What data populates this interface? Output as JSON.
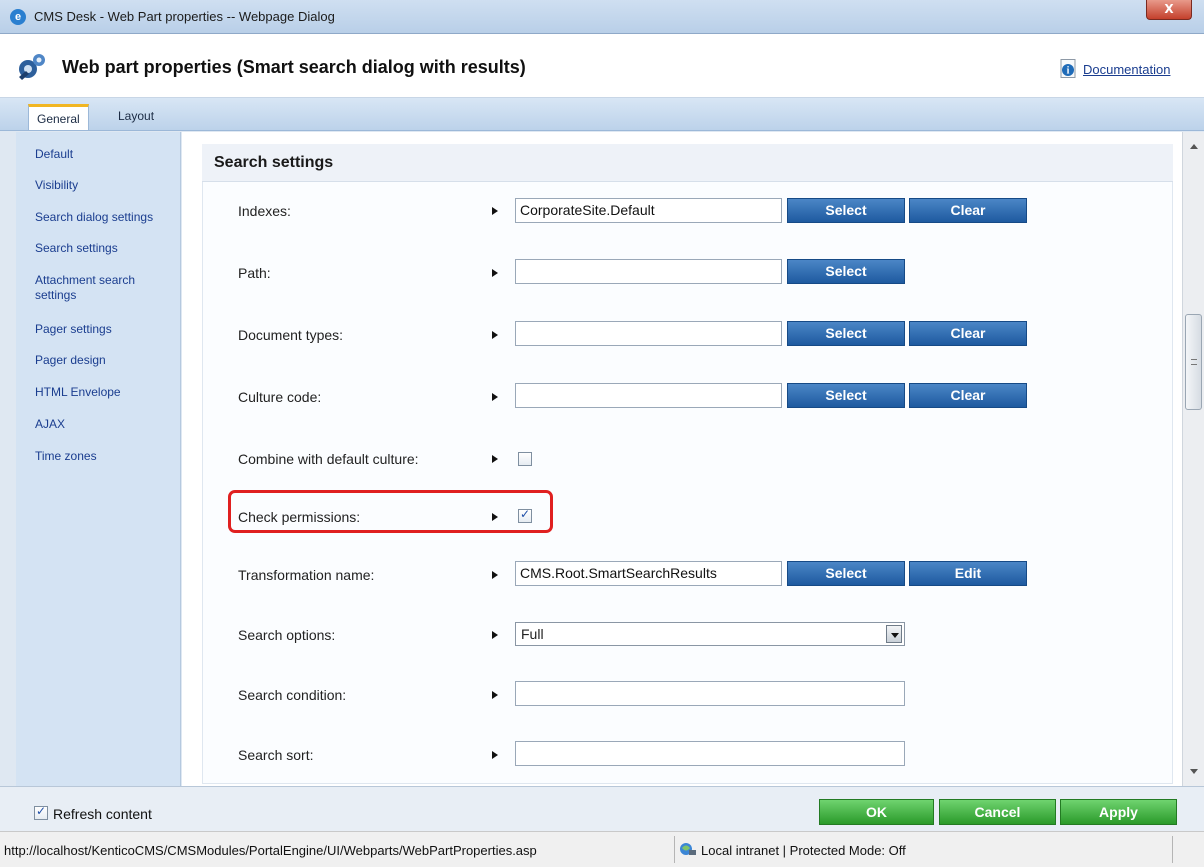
{
  "window": {
    "title": "CMS Desk - Web Part properties -- Webpage Dialog",
    "close_symbol": "X"
  },
  "header": {
    "title": "Web part properties (Smart search dialog with results)",
    "documentation": "Documentation"
  },
  "tabs": [
    {
      "label": "General",
      "active": true
    },
    {
      "label": "Layout",
      "active": false
    }
  ],
  "sidebar": {
    "items": [
      {
        "label": "Default"
      },
      {
        "label": "Visibility"
      },
      {
        "label": "Search dialog settings"
      },
      {
        "label": "Search settings"
      },
      {
        "label": "Attachment search settings"
      },
      {
        "label": "Pager settings"
      },
      {
        "label": "Pager design"
      },
      {
        "label": "HTML Envelope"
      },
      {
        "label": "AJAX"
      },
      {
        "label": "Time zones"
      }
    ]
  },
  "section": {
    "title": "Search settings"
  },
  "fields": {
    "indexes": {
      "label": "Indexes:",
      "value": "CorporateSite.Default",
      "select": "Select",
      "clear": "Clear"
    },
    "path": {
      "label": "Path:",
      "value": "",
      "select": "Select"
    },
    "document_types": {
      "label": "Document types:",
      "value": "",
      "select": "Select",
      "clear": "Clear"
    },
    "culture_code": {
      "label": "Culture code:",
      "value": "",
      "select": "Select",
      "clear": "Clear"
    },
    "combine_default_culture": {
      "label": "Combine with default culture:",
      "checked": false
    },
    "check_permissions": {
      "label": "Check permissions:",
      "checked": true
    },
    "transformation_name": {
      "label": "Transformation name:",
      "value": "CMS.Root.SmartSearchResults",
      "select": "Select",
      "edit": "Edit"
    },
    "search_options": {
      "label": "Search options:",
      "value": "Full"
    },
    "search_condition": {
      "label": "Search condition:",
      "value": ""
    },
    "search_sort": {
      "label": "Search sort:",
      "value": ""
    }
  },
  "footer": {
    "refresh_label": "Refresh content",
    "refresh_checked": true,
    "ok": "OK",
    "cancel": "Cancel",
    "apply": "Apply"
  },
  "statusbar": {
    "url": "http://localhost/KenticoCMS/CMSModules/PortalEngine/UI/Webparts/WebPartProperties.asp",
    "zone": "Local intranet | Protected Mode: Off"
  },
  "colors": {
    "highlight": "#e02020",
    "primary_button": "#2a67ad",
    "green_button": "#2a9a2a",
    "link": "#1a3d8f"
  }
}
